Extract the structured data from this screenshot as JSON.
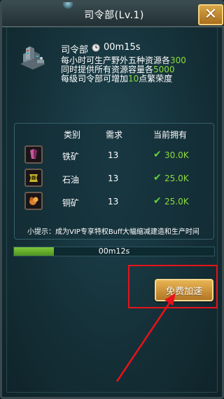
{
  "title": "司令部(Lv.1)",
  "close_label": "✕",
  "building": {
    "name": "司令部",
    "time": "00m15s",
    "line1": {
      "prefix": "每小时可生产野外五种资源各",
      "value": "300"
    },
    "line2": {
      "prefix": "同时提供所有资源容量各",
      "value": "5000"
    },
    "line3": {
      "prefix": "每级司令部可增加",
      "value": "10",
      "suffix": "点繁荣度"
    }
  },
  "table": {
    "headers": [
      "类别",
      "需求",
      "当前拥有"
    ],
    "rows": [
      {
        "name": "铁矿",
        "need": "13",
        "have": "30.0K",
        "icon": "iron-ore-icon"
      },
      {
        "name": "石油",
        "need": "13",
        "have": "25.0K",
        "icon": "oil-icon"
      },
      {
        "name": "铜矿",
        "need": "13",
        "have": "25.0K",
        "icon": "copper-ore-icon"
      }
    ]
  },
  "tip": "小提示：成为VIP专享特权Buff大幅缩减建造和生产时间",
  "progress": {
    "label": "00m12s",
    "fraction": 0.2
  },
  "speedup_button": "免费加速",
  "colors": {
    "highlight": "#8fdc3c",
    "annotation": "#e8121a",
    "button": "#d39a3a"
  }
}
